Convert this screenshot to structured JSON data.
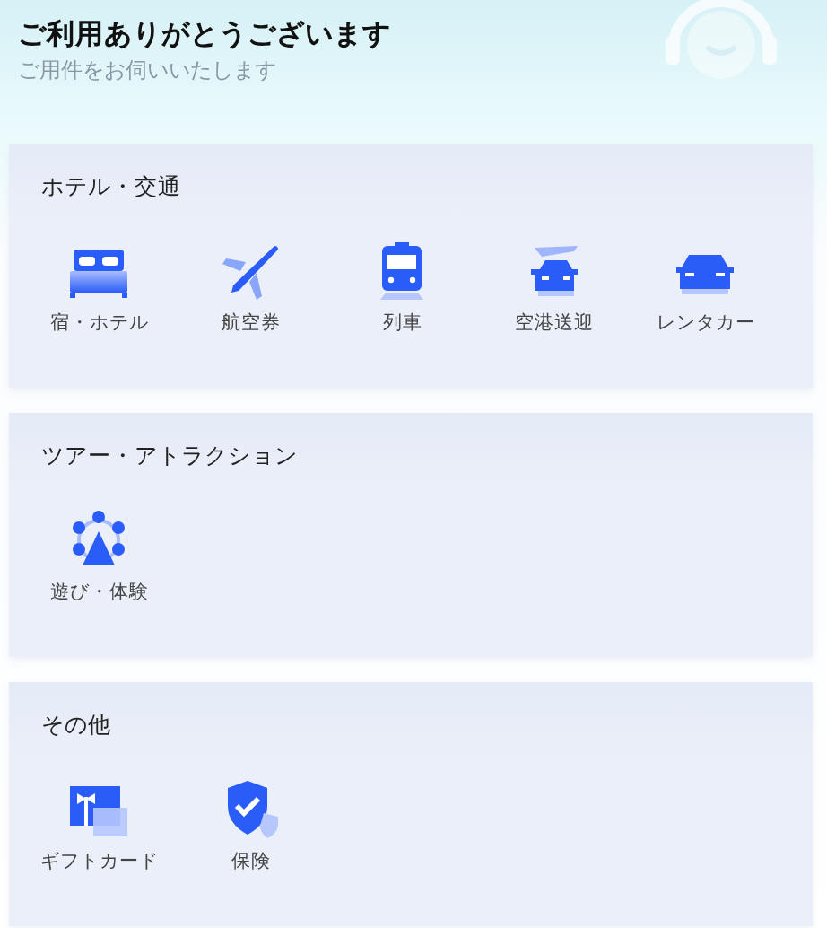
{
  "header": {
    "title": "ご利用ありがとうございます",
    "subtitle": "ご用件をお伺いいたします"
  },
  "sections": [
    {
      "title": "ホテル・交通",
      "items": [
        {
          "kind": "bed",
          "label": "宿・ホテル"
        },
        {
          "kind": "plane",
          "label": "航空券"
        },
        {
          "kind": "train",
          "label": "列車"
        },
        {
          "kind": "transfer",
          "label": "空港送迎"
        },
        {
          "kind": "car",
          "label": "レンタカー"
        }
      ]
    },
    {
      "title": "ツアー・アトラクション",
      "items": [
        {
          "kind": "ferris",
          "label": "遊び・体験"
        }
      ]
    },
    {
      "title": "その他",
      "items": [
        {
          "kind": "gift",
          "label": "ギフトカード"
        },
        {
          "kind": "shield",
          "label": "保険"
        }
      ]
    }
  ]
}
